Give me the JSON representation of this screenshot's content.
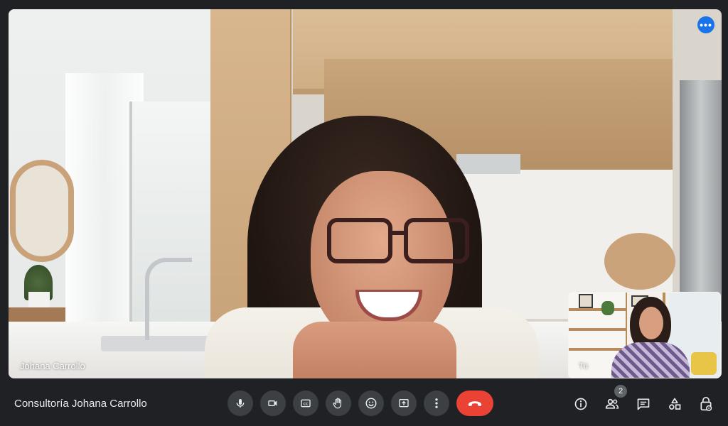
{
  "participant": {
    "name": "Johana Carrollo"
  },
  "self_view": {
    "label": "Tú"
  },
  "meeting": {
    "title": "Consultoría Johana Carrollo"
  },
  "people_count": "2",
  "colors": {
    "background": "#202124",
    "control": "#3c4043",
    "end_call": "#ea4335",
    "accent": "#1a73e8"
  },
  "icons": {
    "more": "more-horizontal-icon",
    "mic": "microphone-icon",
    "camera": "video-camera-icon",
    "captions": "closed-captions-icon",
    "hand": "raise-hand-icon",
    "emoji": "emoji-icon",
    "present": "present-screen-icon",
    "more_options": "more-vertical-icon",
    "end": "end-call-icon",
    "info": "info-icon",
    "people": "people-icon",
    "chat": "chat-icon",
    "activities": "activities-icon",
    "host": "host-controls-icon"
  }
}
